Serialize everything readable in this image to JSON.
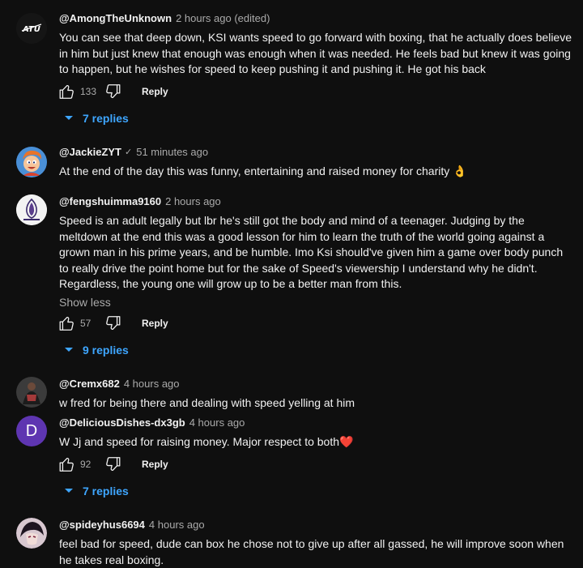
{
  "comments": [
    {
      "author": "@AmongTheUnknown",
      "time": "2 hours ago (edited)",
      "text": "You can see that deep down, KSI wants speed to go forward with boxing, that he actually does believe in him but just knew that enough was enough when it was needed. He feels bad but knew it was going to happen, but he wishes for speed to keep pushing it and pushing it. He got his back",
      "likes": "133",
      "reply_label": "Reply",
      "replies_label": "7 replies",
      "avatar_text": "ATU"
    },
    {
      "author": "@JackieZYT",
      "verified": "✓",
      "time": "51 minutes ago",
      "text": "At the end of the day this was funny, entertaining and raised money for charity 👌"
    },
    {
      "author": "@fengshuimma9160",
      "time": "2 hours ago",
      "text": "Speed is an adult legally but lbr he's still got the body and mind of a teenager.  Judging by the meltdown at the end this was a good lesson for him to learn the truth of the world going against a grown man in his prime years, and be humble.  Imo Ksi should've given him a game over body punch to really drive the point home but for the sake of Speed's viewership I understand why he didn't. Regardless, the young one will grow up to be a better man from this.",
      "show_less": "Show less",
      "likes": "57",
      "reply_label": "Reply",
      "replies_label": "9 replies"
    },
    {
      "author": "@Cremx682",
      "time": "4 hours ago",
      "text": "w fred for being there and dealing with speed yelling at him"
    },
    {
      "author": "@DeliciousDishes-dx3gb",
      "time": "4 hours ago",
      "text": "W Jj and speed for raising money. Major respect to both❤️",
      "likes": "92",
      "reply_label": "Reply",
      "replies_label": "7 replies",
      "avatar_letter": "D"
    },
    {
      "author": "@spideyhus6694",
      "time": "4 hours ago",
      "text": "feel bad for speed, dude can box he chose not to give up after all gassed, he will improve soon when he takes real boxing."
    }
  ],
  "colors": {
    "background": "#0f0f0f",
    "text": "#f1f1f1",
    "secondary": "#aaaaaa",
    "link": "#3ea6ff",
    "avatar_purple": "#5e35b1"
  }
}
